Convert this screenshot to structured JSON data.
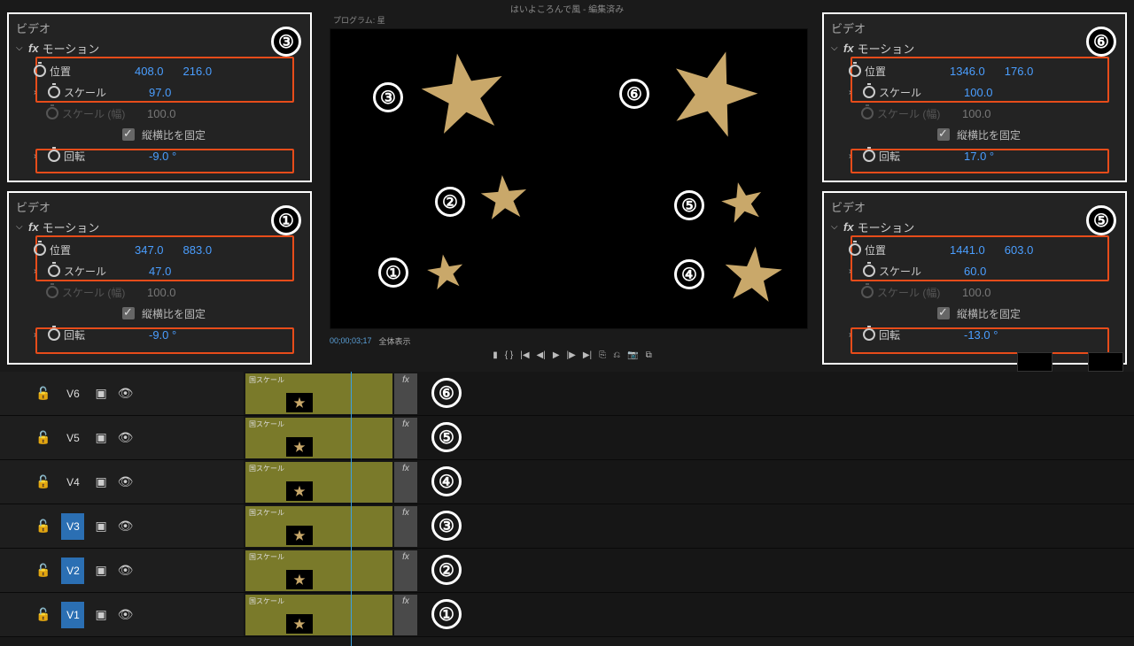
{
  "app": {
    "title": "はいよころんで風 - 編集済み"
  },
  "program": {
    "tab": "プログラム: 星",
    "timecode": "00;00;03;17",
    "zoom": "全体表示"
  },
  "labels": {
    "video": "ビデオ",
    "motion": "モーション",
    "position": "位置",
    "scale": "スケール",
    "scale_w": "スケール (幅)",
    "aspect_lock": "縦横比を固定",
    "rotation": "回転",
    "clip_label": "国スケール"
  },
  "panels": {
    "p3": {
      "badge": "③",
      "pos_x": "408.0",
      "pos_y": "216.0",
      "scale": "97.0",
      "scale_w": "100.0",
      "rotation": "-9.0 °"
    },
    "p1": {
      "badge": "①",
      "pos_x": "347.0",
      "pos_y": "883.0",
      "scale": "47.0",
      "scale_w": "100.0",
      "rotation": "-9.0 °"
    },
    "p6": {
      "badge": "⑥",
      "pos_x": "1346.0",
      "pos_y": "176.0",
      "scale": "100.0",
      "scale_w": "100.0",
      "rotation": "17.0 °"
    },
    "p5": {
      "badge": "⑤",
      "pos_x": "1441.0",
      "pos_y": "603.0",
      "scale": "60.0",
      "scale_w": "100.0",
      "rotation": "-13.0 °"
    }
  },
  "canvas": {
    "stars": {
      "s1": {
        "badge": "①"
      },
      "s2": {
        "badge": "②"
      },
      "s3": {
        "badge": "③"
      },
      "s4": {
        "badge": "④"
      },
      "s5": {
        "badge": "⑤"
      },
      "s6": {
        "badge": "⑥"
      }
    }
  },
  "tracks": [
    {
      "name": "V6",
      "badge": "⑥",
      "selected": false
    },
    {
      "name": "V5",
      "badge": "⑤",
      "selected": false
    },
    {
      "name": "V4",
      "badge": "④",
      "selected": false
    },
    {
      "name": "V3",
      "badge": "③",
      "selected": true
    },
    {
      "name": "V2",
      "badge": "②",
      "selected": true
    },
    {
      "name": "V1",
      "badge": "①",
      "selected": true
    }
  ]
}
